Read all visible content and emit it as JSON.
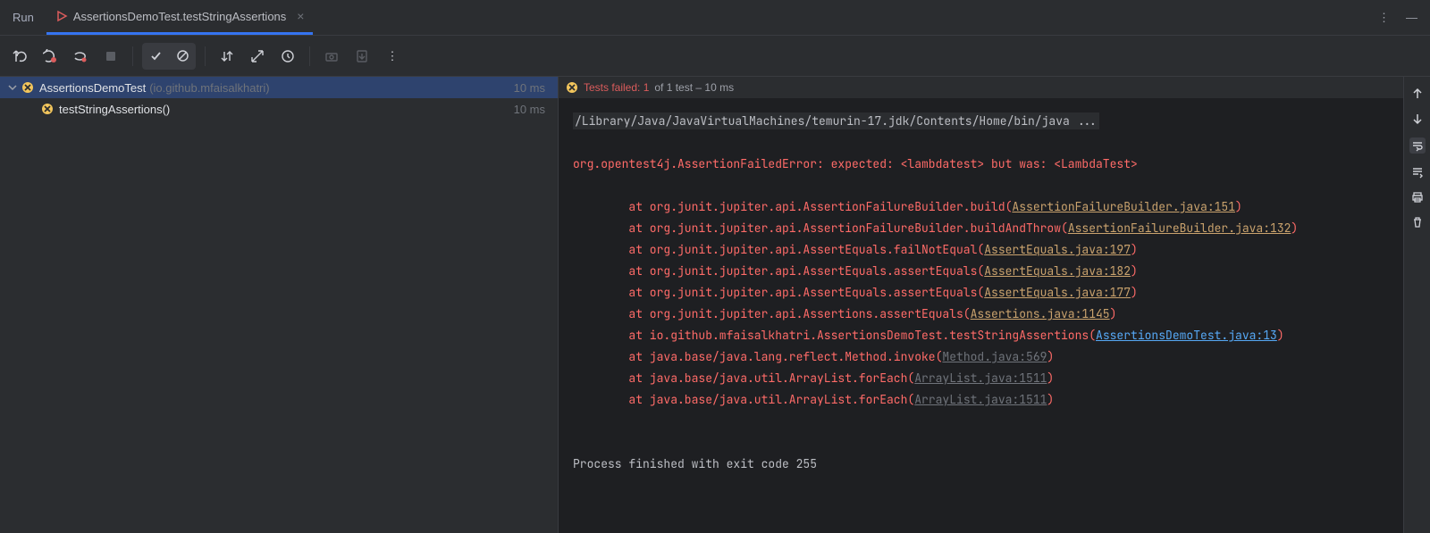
{
  "header": {
    "run_label": "Run",
    "tab_title": "AssertionsDemoTest.testStringAssertions"
  },
  "tree": {
    "root": {
      "name": "AssertionsDemoTest",
      "package": "(io.github.mfaisalkhatri)",
      "time": "10 ms"
    },
    "child": {
      "name": "testStringAssertions()",
      "time": "10 ms"
    }
  },
  "summary": {
    "fail_prefix": "Tests failed: 1",
    "rest": " of 1 test – 10 ms"
  },
  "console": {
    "cmd": "/Library/Java/JavaVirtualMachines/temurin-17.jdk/Contents/Home/bin/java ...",
    "error_line": "org.opentest4j.AssertionFailedError: expected: <lambdatest> but was: <LambdaTest>",
    "frames": [
      {
        "pre": "\tat org.junit.jupiter.api.AssertionFailureBuilder.build(",
        "link": "AssertionFailureBuilder.java:151",
        "kind": "orange"
      },
      {
        "pre": "\tat org.junit.jupiter.api.AssertionFailureBuilder.buildAndThrow(",
        "link": "AssertionFailureBuilder.java:132",
        "kind": "orange"
      },
      {
        "pre": "\tat org.junit.jupiter.api.AssertEquals.failNotEqual(",
        "link": "AssertEquals.java:197",
        "kind": "orange"
      },
      {
        "pre": "\tat org.junit.jupiter.api.AssertEquals.assertEquals(",
        "link": "AssertEquals.java:182",
        "kind": "orange"
      },
      {
        "pre": "\tat org.junit.jupiter.api.AssertEquals.assertEquals(",
        "link": "AssertEquals.java:177",
        "kind": "orange"
      },
      {
        "pre": "\tat org.junit.jupiter.api.Assertions.assertEquals(",
        "link": "Assertions.java:1145",
        "kind": "orange"
      },
      {
        "pre": "\tat io.github.mfaisalkhatri.AssertionsDemoTest.testStringAssertions(",
        "link": "AssertionsDemoTest.java:13",
        "kind": "blue"
      },
      {
        "pre": "\tat java.base/java.lang.reflect.Method.invoke(",
        "link": "Method.java:569",
        "kind": "gray"
      },
      {
        "pre": "\tat java.base/java.util.ArrayList.forEach(",
        "link": "ArrayList.java:1511",
        "kind": "gray"
      },
      {
        "pre": "\tat java.base/java.util.ArrayList.forEach(",
        "link": "ArrayList.java:1511",
        "kind": "gray"
      }
    ],
    "exit": "Process finished with exit code 255"
  }
}
